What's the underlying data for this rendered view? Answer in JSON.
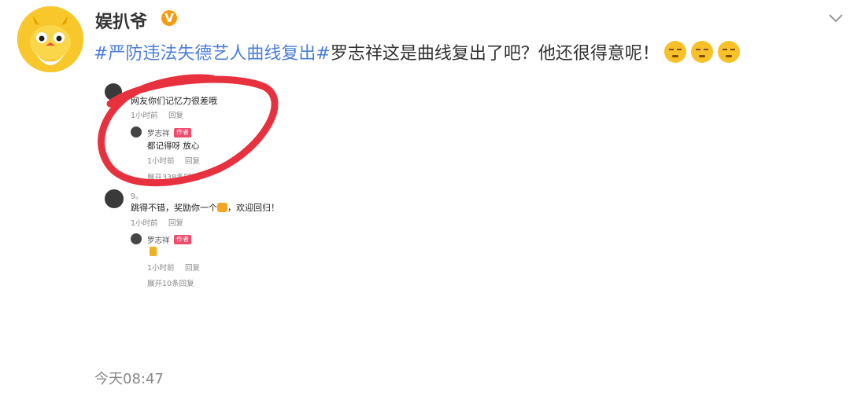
{
  "post": {
    "username": "娱扒爷",
    "verified_badge": "V",
    "hashtag": "#严防违法失德艺人曲线复出#",
    "text": "罗志祥这是曲线复出了吧？他还很得意呢！",
    "emoji_icons": [
      "smirk-emoji-icon",
      "smirk-emoji-icon",
      "smirk-emoji-icon"
    ],
    "timestamp": "今天08:47"
  },
  "screenshot": {
    "comment1": {
      "text": "网友你们记忆力很差哦",
      "time": "1小时前",
      "reply": "回复",
      "reply_item": {
        "name": "罗志祥",
        "badge": "作者",
        "text": "都记得呀 放心",
        "time": "1小时前",
        "reply": "回复"
      },
      "expand": "展开338条回复"
    },
    "comment2": {
      "user": "9。",
      "text_before": "跳得不错，奖励你一个",
      "text_after": "，欢迎回归！",
      "time": "1小时前",
      "reply": "回复",
      "reply_item": {
        "name": "罗志祥",
        "badge": "作者",
        "time": "1小时前",
        "reply": "回复"
      },
      "expand": "展开10条回复"
    }
  },
  "colors": {
    "link": "#4c7ed8",
    "annotation_circle": "#e8313e",
    "author_badge": "#f04a6c"
  }
}
